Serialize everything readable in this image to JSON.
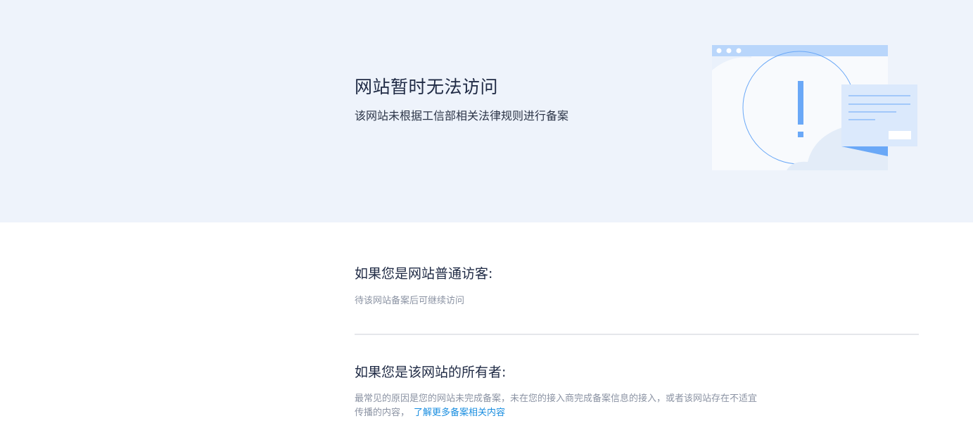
{
  "hero": {
    "title": "网站暂时无法访问",
    "subtitle": "该网站未根据工信部相关法律规则进行备案"
  },
  "illustration": {
    "icon": "warning-browser-illustration",
    "accent_color": "#6aa8f7",
    "light_color": "#b9d6fb"
  },
  "visitor": {
    "heading": "如果您是网站普通访客:",
    "text": "待该网站备案后可继续访问"
  },
  "owner": {
    "heading": "如果您是该网站的所有者:",
    "text": "最常见的原因是您的网站未完成备案，未在您的接入商完成备案信息的接入，或者该网站存在不适宜传播的内容，",
    "link_label": "了解更多备案相关内容"
  },
  "colors": {
    "hero_background": "#eef3fb",
    "link": "#1a8ee0",
    "muted_text": "#8b93a3"
  }
}
